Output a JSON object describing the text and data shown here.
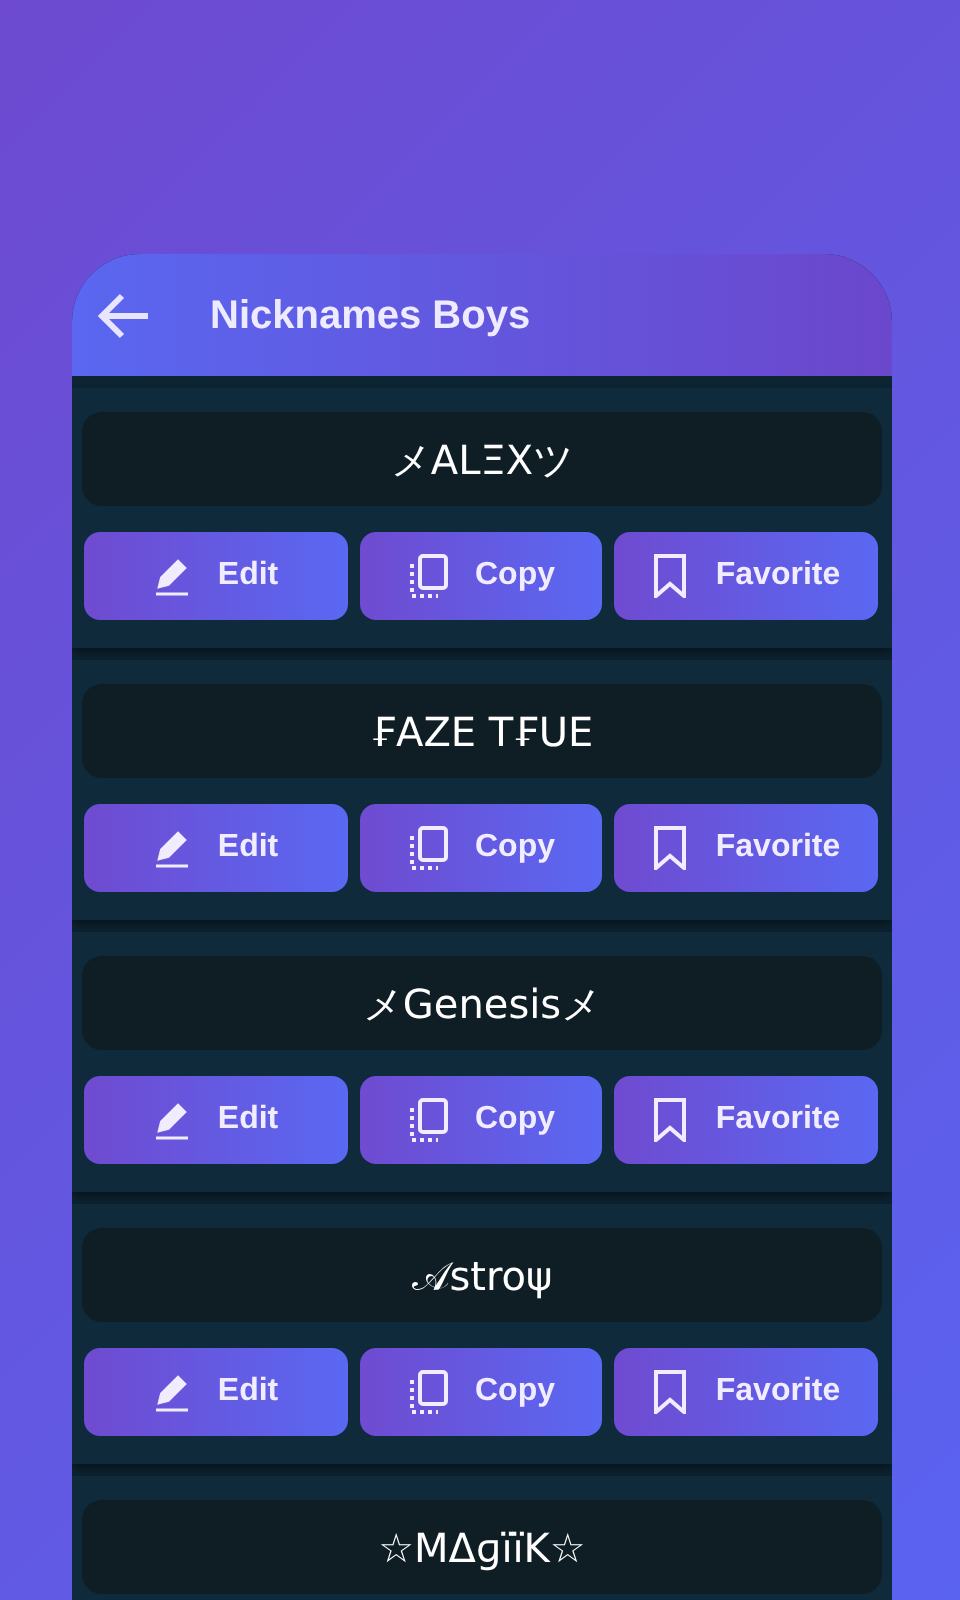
{
  "header": {
    "title": "Nicknames Boys"
  },
  "nicknames": [
    {
      "name": "メALΞXツ",
      "actions": [
        {
          "kind": "edit",
          "label": "Edit"
        },
        {
          "kind": "copy",
          "label": "Copy"
        },
        {
          "kind": "favorite",
          "label": "Favorite"
        }
      ]
    },
    {
      "name": "₣AZE T₣UE",
      "actions": [
        {
          "kind": "edit",
          "label": "Edit"
        },
        {
          "kind": "copy",
          "label": "Copy"
        },
        {
          "kind": "favorite",
          "label": "Favorite"
        }
      ]
    },
    {
      "name": "メGenesisメ",
      "actions": [
        {
          "kind": "edit",
          "label": "Edit"
        },
        {
          "kind": "copy",
          "label": "Copy"
        },
        {
          "kind": "favorite",
          "label": "Favorite"
        }
      ]
    },
    {
      "name": "𝒜stroψ",
      "actions": [
        {
          "kind": "edit",
          "label": "Edit"
        },
        {
          "kind": "copy",
          "label": "Copy"
        },
        {
          "kind": "favorite",
          "label": "Favorite"
        }
      ]
    },
    {
      "name": "☆MΔɡïïK☆"
    }
  ]
}
